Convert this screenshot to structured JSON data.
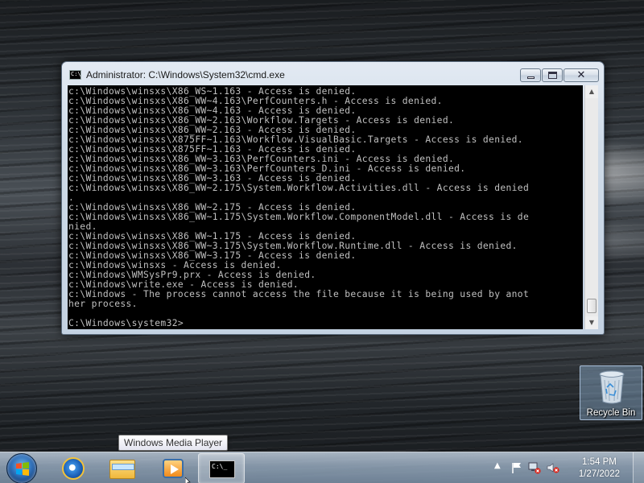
{
  "window": {
    "title": "Administrator: C:\\Windows\\System32\\cmd.exe",
    "icon": "cmd-icon",
    "icon_text": "C:\\"
  },
  "console": {
    "lines": [
      "c:\\Windows\\winsxs\\X86_WS~1.163 - Access is denied.",
      "c:\\Windows\\winsxs\\X86_WW~4.163\\PerfCounters.h - Access is denied.",
      "c:\\Windows\\winsxs\\X86_WW~4.163 - Access is denied.",
      "c:\\Windows\\winsxs\\X86_WW~2.163\\Workflow.Targets - Access is denied.",
      "c:\\Windows\\winsxs\\X86_WW~2.163 - Access is denied.",
      "c:\\Windows\\winsxs\\X875FF~1.163\\Workflow.VisualBasic.Targets - Access is denied.",
      "c:\\Windows\\winsxs\\X875FF~1.163 - Access is denied.",
      "c:\\Windows\\winsxs\\X86_WW~3.163\\PerfCounters.ini - Access is denied.",
      "c:\\Windows\\winsxs\\X86_WW~3.163\\PerfCounters_D.ini - Access is denied.",
      "c:\\Windows\\winsxs\\X86_WW~3.163 - Access is denied.",
      "c:\\Windows\\winsxs\\X86_WW~2.175\\System.Workflow.Activities.dll - Access is denied",
      ".",
      "c:\\Windows\\winsxs\\X86_WW~2.175 - Access is denied.",
      "c:\\Windows\\winsxs\\X86_WW~1.175\\System.Workflow.ComponentModel.dll - Access is de",
      "nied.",
      "c:\\Windows\\winsxs\\X86_WW~1.175 - Access is denied.",
      "c:\\Windows\\winsxs\\X86_WW~3.175\\System.Workflow.Runtime.dll - Access is denied.",
      "c:\\Windows\\winsxs\\X86_WW~3.175 - Access is denied.",
      "c:\\Windows\\winsxs - Access is denied.",
      "c:\\Windows\\WMSysPr9.prx - Access is denied.",
      "c:\\Windows\\write.exe - Access is denied.",
      "c:\\Windows - The process cannot access the file because it is being used by anot",
      "her process.",
      "",
      "C:\\Windows\\system32>"
    ],
    "text_color": "#c0c0c0",
    "background": "#000000"
  },
  "desktop": {
    "recycle_bin_label": "Recycle Bin"
  },
  "tooltip": {
    "text": "Windows Media Player"
  },
  "taskbar": {
    "pinned": [
      {
        "name": "internet-explorer-icon"
      },
      {
        "name": "windows-explorer-icon"
      },
      {
        "name": "windows-media-player-icon"
      },
      {
        "name": "command-prompt-icon"
      }
    ],
    "cmd_glyph_text": "C:\\_",
    "tray_arrow": "▲",
    "clock": {
      "time": "1:54 PM",
      "date": "1/27/2022"
    }
  }
}
